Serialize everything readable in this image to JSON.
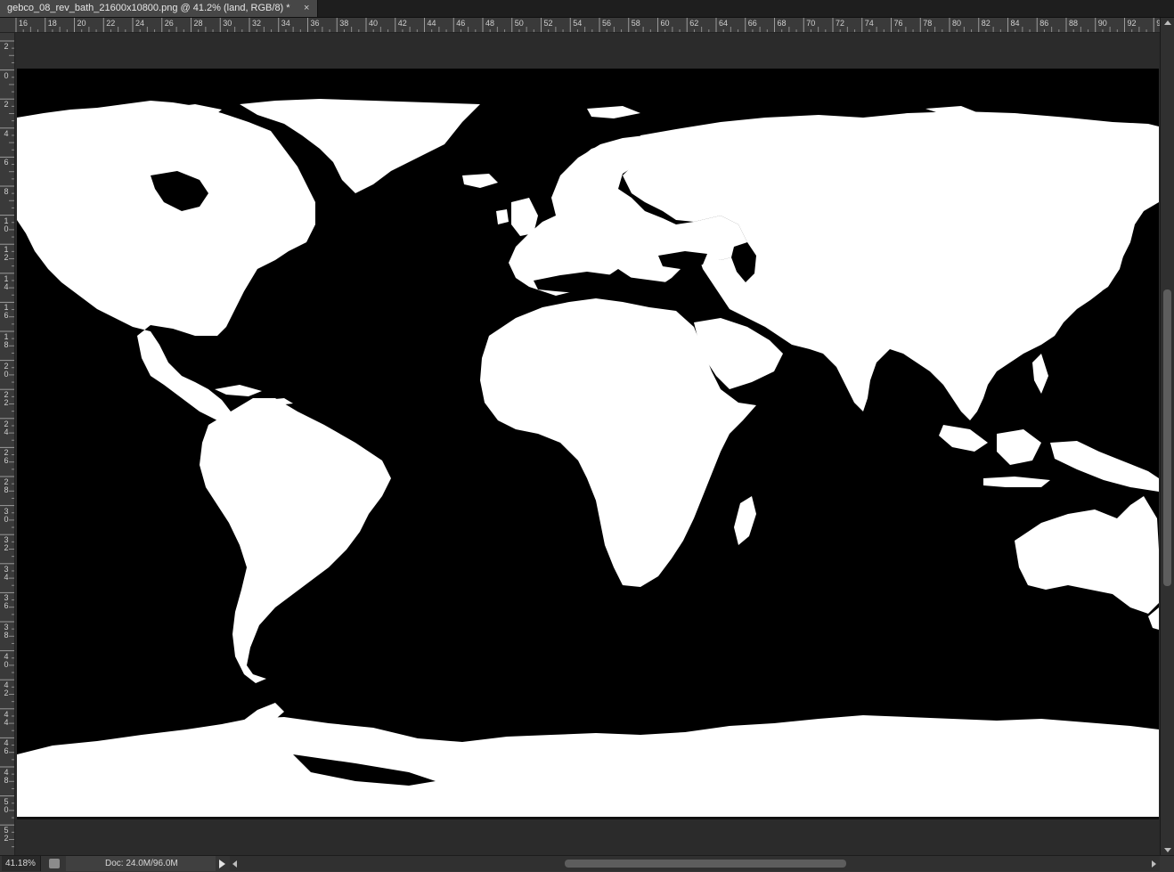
{
  "document_tab": {
    "title": "gebco_08_rev_bath_21600x10800.png @ 41.2% (land, RGB/8) *",
    "close_glyph": "×"
  },
  "ruler_top": {
    "labels": [
      "16",
      "18",
      "20",
      "22",
      "24",
      "26",
      "28",
      "30",
      "32",
      "34",
      "36",
      "38",
      "40",
      "42",
      "44",
      "46",
      "48",
      "50",
      "52",
      "54",
      "56",
      "58",
      "60",
      "62",
      "64",
      "66",
      "68",
      "70",
      "72",
      "74",
      "76",
      "78",
      "80",
      "82",
      "84",
      "86",
      "88",
      "90",
      "92",
      "94"
    ]
  },
  "ruler_left": {
    "labels": [
      "2",
      "0",
      "2",
      "4",
      "6",
      "8",
      "10",
      "12",
      "14",
      "16",
      "18",
      "20",
      "22",
      "24",
      "26",
      "28",
      "30",
      "32",
      "34",
      "36",
      "38",
      "40",
      "42",
      "44",
      "46",
      "48",
      "50",
      "52"
    ]
  },
  "canvas": {
    "layer": "land",
    "background_color": "#000000",
    "land_color": "#ffffff",
    "content": "world map land mask"
  },
  "status_bar": {
    "zoom": "41.18%",
    "doc_info": "Doc: 24.0M/96.0M",
    "icons": [
      "doc-status-icon",
      "status-menu-arrow-icon"
    ]
  },
  "scrollbars": {
    "icons": [
      "scroll-up-arrow-icon",
      "scroll-down-arrow-icon",
      "scroll-left-arrow-icon",
      "scroll-right-arrow-icon"
    ]
  }
}
